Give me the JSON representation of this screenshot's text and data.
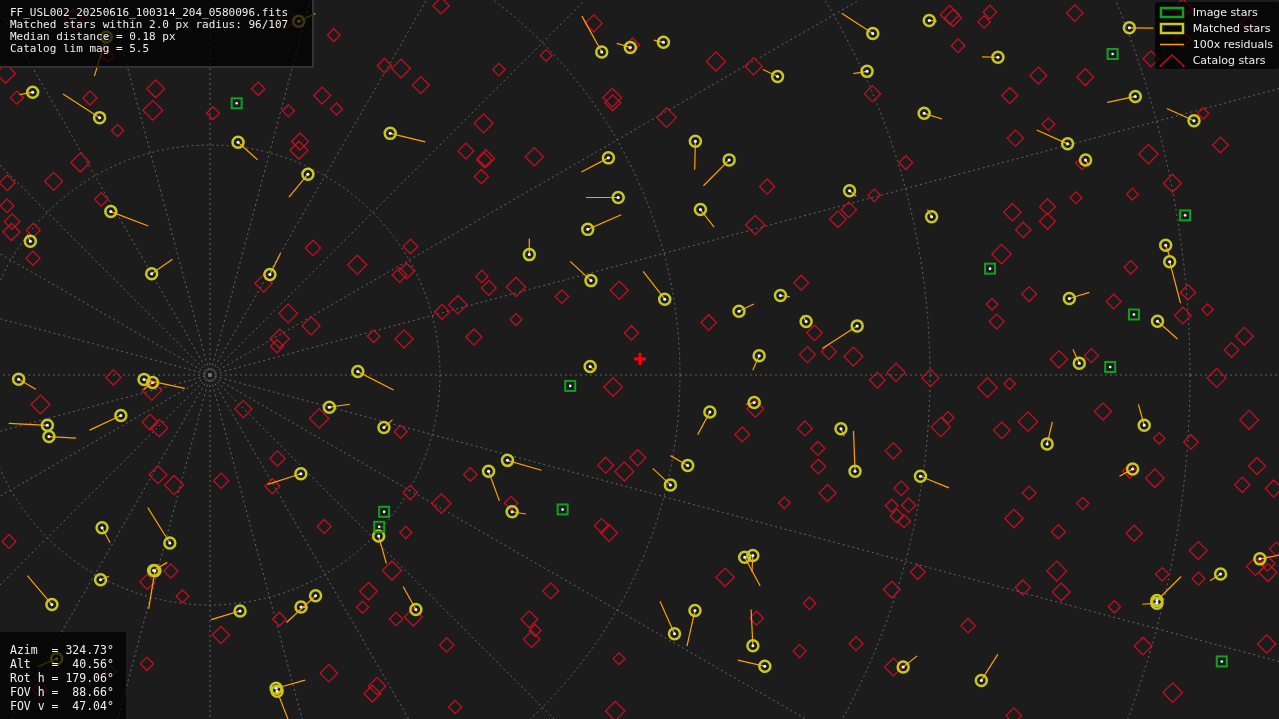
{
  "info_panel": {
    "lines": [
      "FF_USL002_20250616_100314_204_0580096.fits",
      "Matched stars within 2.0 px radius: 96/107",
      "Median distance = 0.18 px",
      "Catalog lim mag = 5.5"
    ]
  },
  "legend": {
    "items": [
      {
        "kind": "image",
        "label": "Image stars"
      },
      {
        "kind": "matched",
        "label": "Matched stars"
      },
      {
        "kind": "residual",
        "label": "100x residuals"
      },
      {
        "kind": "catalog",
        "label": "Catalog stars"
      }
    ]
  },
  "pointing_panel": {
    "lines": [
      "Azim  = 324.73°",
      "Alt   =  40.56°",
      "Rot h = 179.06°",
      "FOV h =  88.66°",
      "FOV v =  47.04°"
    ]
  }
}
